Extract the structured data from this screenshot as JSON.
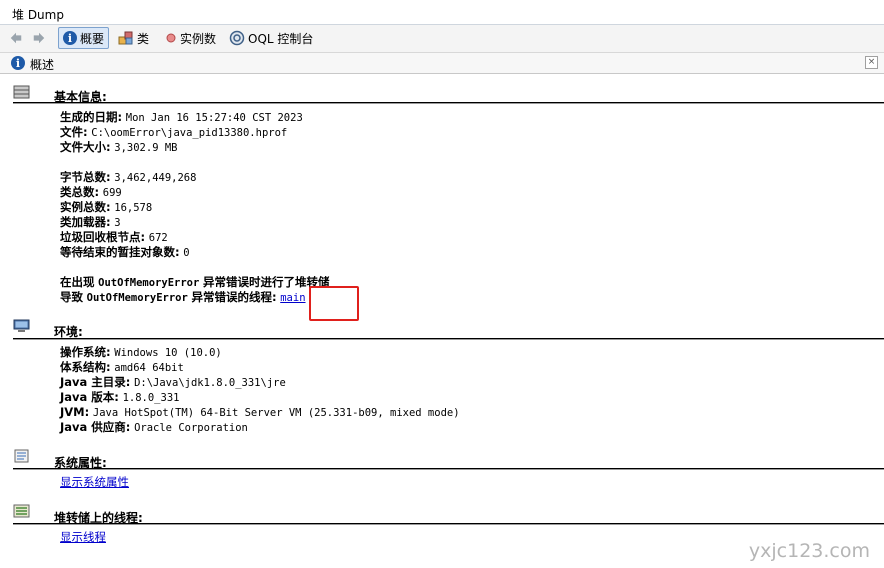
{
  "window": {
    "title": "堆 Dump"
  },
  "toolbar": {
    "summary_label": "概要",
    "classes_label": "类",
    "instances_label": "实例数",
    "oql_label": "OQL 控制台"
  },
  "subbar": {
    "label": "概述"
  },
  "basic": {
    "title": "基本信息:",
    "generated_label": "生成的日期:",
    "generated_value": "Mon Jan 16 15:27:40 CST 2023",
    "file_label": "文件:",
    "file_value": "C:\\oomError\\java_pid13380.hprof",
    "size_label": "文件大小:",
    "size_value": "3,302.9 MB",
    "bytes_label": "字节总数:",
    "bytes_value": "3,462,449,268",
    "classes_label": "类总数:",
    "classes_value": "699",
    "instances_label": "实例总数:",
    "instances_value": "16,578",
    "loaders_label": "类加载器:",
    "loaders_value": "3",
    "gcroots_label": "垃圾回收根节点:",
    "gcroots_value": "672",
    "pending_label": "等待结束的暂挂对象数:",
    "pending_value": "0",
    "oom_line1_prefix": "在出现",
    "oom_line1_error": "OutOfMemoryError",
    "oom_line1_suffix": "异常错误时进行了堆转储",
    "oom_line2_prefix": "导致",
    "oom_line2_error": "OutOfMemoryError",
    "oom_line2_suffix": "异常错误的线程:",
    "oom_thread_link": "main"
  },
  "env": {
    "title": "环境:",
    "os_label": "操作系统:",
    "os_value": "Windows 10 (10.0)",
    "arch_label": "体系结构:",
    "arch_value": "amd64 64bit",
    "home_label": "Java 主目录:",
    "home_value": "D:\\Java\\jdk1.8.0_331\\jre",
    "version_label": "Java 版本:",
    "version_value": "1.8.0_331",
    "jvm_label": "JVM:",
    "jvm_value": "Java HotSpot(TM) 64-Bit Server VM (25.331-b09, mixed mode)",
    "vendor_label": "Java 供应商:",
    "vendor_value": "Oracle Corporation"
  },
  "sysprops": {
    "title": "系统属性:",
    "link": "显示系统属性"
  },
  "threads": {
    "title": "堆转储上的线程:",
    "link": "显示线程"
  },
  "watermark": "yxjc123.com",
  "colors": {
    "link": "#0000cc",
    "highlight": "#e0201c",
    "toolbar_active": "#dbe8f8"
  }
}
